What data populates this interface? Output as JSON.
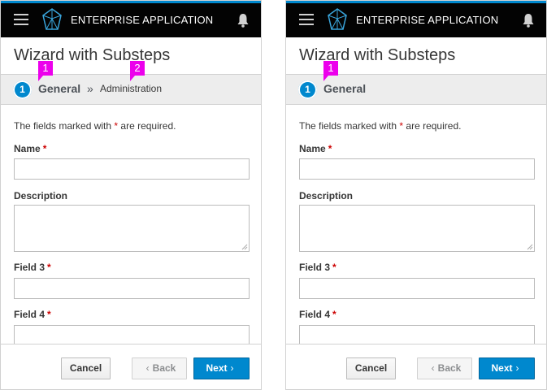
{
  "left": {
    "app_title": "ENTERPRISE APPLICATION",
    "wizard_title": "Wizard with Substeps",
    "step_number": "1",
    "step_active": "General",
    "step_separator": "»",
    "step_sub": "Administration",
    "callout_1": "1",
    "callout_2": "2",
    "required_note_prefix": "The fields marked with",
    "required_star": "*",
    "required_note_suffix": "are required.",
    "fields": [
      {
        "label": "Name",
        "required": true
      },
      {
        "label": "Description",
        "required": false
      },
      {
        "label": "Field 3",
        "required": true
      },
      {
        "label": "Field 4",
        "required": true
      }
    ],
    "buttons": {
      "cancel": "Cancel",
      "back": "Back",
      "next": "Next"
    }
  },
  "right": {
    "app_title": "ENTERPRISE APPLICATION",
    "wizard_title": "Wizard with Substeps",
    "step_number": "1",
    "step_active": "General",
    "callout_1": "1",
    "required_note_prefix": "The fields marked with",
    "required_star": "*",
    "required_note_suffix": "are required.",
    "fields": [
      {
        "label": "Name",
        "required": true
      },
      {
        "label": "Description",
        "required": false
      },
      {
        "label": "Field 3",
        "required": true
      },
      {
        "label": "Field 4",
        "required": true
      }
    ],
    "buttons": {
      "cancel": "Cancel",
      "back": "Back",
      "next": "Next"
    }
  },
  "colors": {
    "accent": "#0088ce",
    "callout": "#ec00ec",
    "required": "#cc0000",
    "masthead": "#030303"
  },
  "icons": [
    "hamburger-icon",
    "logo-icon",
    "bell-icon",
    "chevron-left-icon",
    "chevron-right-icon"
  ]
}
